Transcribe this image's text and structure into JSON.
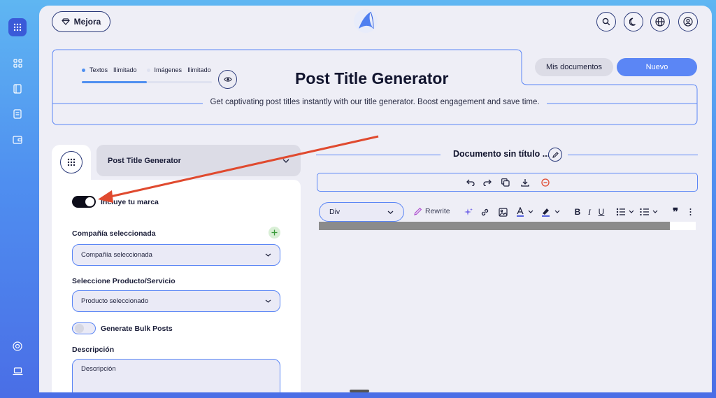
{
  "header": {
    "upgrade_label": "Mejora"
  },
  "hero": {
    "quota": {
      "texts_label": "Textos",
      "texts_value": "Ilimitado",
      "images_label": "Imágenes",
      "images_value": "Ilimitado",
      "usage_fraction": 0.5
    },
    "title": "Post Title Generator",
    "description": "Get captivating post titles instantly with our title generator. Boost engagement and save time.",
    "my_documents_label": "Mis documentos",
    "new_label": "Nuevo"
  },
  "tool_panel": {
    "selected_tool": "Post Title Generator",
    "brand_toggle": {
      "label": "Incluye tu marca",
      "on": true
    },
    "company": {
      "label": "Compañía seleccionada",
      "value": "Compañía seleccionada"
    },
    "product": {
      "label": "Seleccione Producto/Servicio",
      "value": "Producto seleccionado"
    },
    "bulk_toggle": {
      "label": "Generate Bulk Posts",
      "on": false
    },
    "description": {
      "label": "Descripción",
      "placeholder": "Descripción"
    }
  },
  "document": {
    "title": "Documento sin título ..."
  },
  "editor": {
    "block_type": "Div",
    "rewrite_label": "Rewrite",
    "bold": "B",
    "italic": "I",
    "underline": "U",
    "quote": "❞"
  },
  "colors": {
    "accent": "#5b86f5",
    "navy": "#2b3a7a",
    "arrow": "#e04a2f"
  }
}
